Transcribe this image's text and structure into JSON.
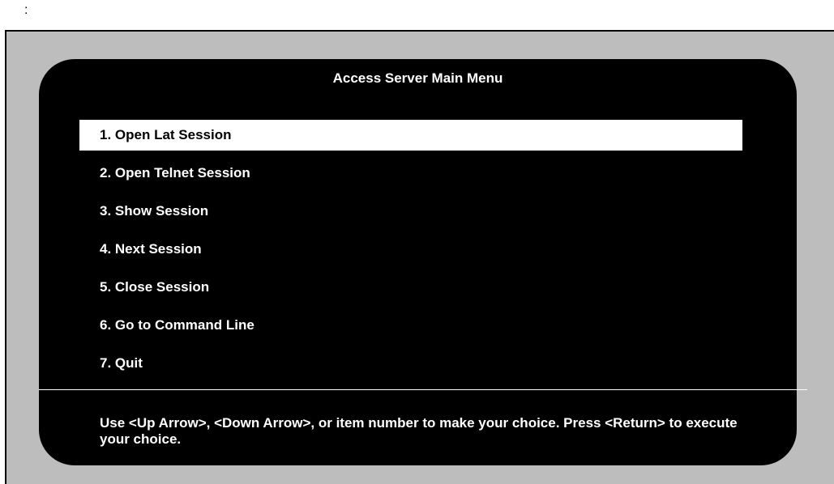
{
  "header_mark": ":",
  "title": "Access Server Main Menu",
  "menu": {
    "selected_index": 0,
    "items": [
      {
        "label": "1. Open Lat Session"
      },
      {
        "label": "2. Open Telnet Session"
      },
      {
        "label": "3. Show Session"
      },
      {
        "label": "4. Next Session"
      },
      {
        "label": "5. Close Session"
      },
      {
        "label": "6. Go to Command Line"
      },
      {
        "label": "7. Quit"
      }
    ]
  },
  "help_text": "Use <Up Arrow>, <Down Arrow>, or item number to make your choice. Press <Return> to execute your choice.",
  "colors": {
    "screen": "#000000",
    "frame": "#bdbdbd",
    "text": "#ffffff",
    "selection": "#ffffff"
  }
}
